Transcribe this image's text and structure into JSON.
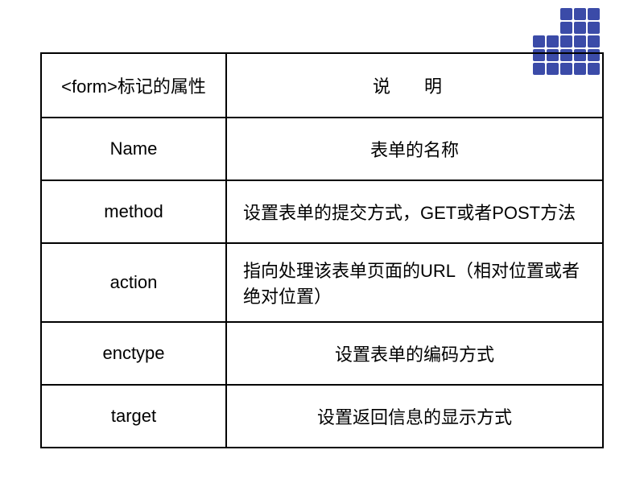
{
  "decoration": {
    "pattern": [
      [
        0,
        0,
        1,
        1,
        1
      ],
      [
        0,
        0,
        1,
        1,
        1
      ],
      [
        1,
        1,
        1,
        1,
        1
      ],
      [
        1,
        1,
        1,
        1,
        1
      ],
      [
        1,
        1,
        1,
        1,
        1
      ]
    ]
  },
  "table": {
    "header": {
      "col1": "<form>标记的属性",
      "col2": "说  明"
    },
    "rows": [
      {
        "attr": "Name",
        "desc": "表单的名称",
        "align": "center"
      },
      {
        "attr": "method",
        "desc": "设置表单的提交方式，GET或者POST方法",
        "align": "left"
      },
      {
        "attr": "action",
        "desc": "指向处理该表单页面的URL（相对位置或者绝对位置）",
        "align": "left"
      },
      {
        "attr": "enctype",
        "desc": "设置表单的编码方式",
        "align": "center"
      },
      {
        "attr": "target",
        "desc": "设置返回信息的显示方式",
        "align": "center"
      }
    ]
  },
  "chart_data": {
    "type": "table",
    "title": "<form>标记的属性",
    "columns": [
      "<form>标记的属性",
      "说明"
    ],
    "rows": [
      [
        "Name",
        "表单的名称"
      ],
      [
        "method",
        "设置表单的提交方式，GET或者POST方法"
      ],
      [
        "action",
        "指向处理该表单页面的URL（相对位置或者绝对位置）"
      ],
      [
        "enctype",
        "设置表单的编码方式"
      ],
      [
        "target",
        "设置返回信息的显示方式"
      ]
    ]
  }
}
